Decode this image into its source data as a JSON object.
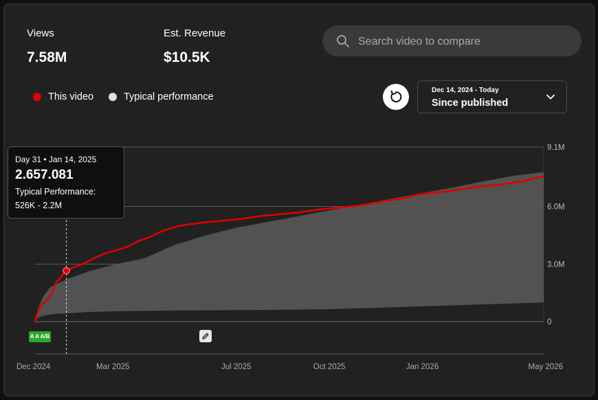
{
  "metrics": {
    "views_label": "Views",
    "views_value": "7.58M",
    "revenue_label": "Est. Revenue",
    "revenue_value": "$10.5K"
  },
  "search": {
    "placeholder": "Search video to compare",
    "icon": "search-icon"
  },
  "legend": {
    "this_video": {
      "label": "This video",
      "color": "#e00000"
    },
    "typical": {
      "label": "Typical performance",
      "color": "#e0e0e0"
    }
  },
  "date_picker": {
    "range": "Dec 14, 2024 - Today",
    "label": "Since published",
    "icon": "chevron-down-icon"
  },
  "refresh": {
    "icon": "refresh-icon"
  },
  "tooltip": {
    "date": "Day 31 • Jan 14, 2025",
    "value": "2.657.081",
    "label": "Typical Performance:",
    "range": "526K - 2.2M"
  },
  "badge": {
    "label": "A A A/B"
  },
  "annotation": {
    "icon": "pencil-icon"
  },
  "colors": {
    "background": "#212121",
    "series": "#e00000",
    "band": "#5a5a5a",
    "grid": "#5f5f5f"
  },
  "chart_data": {
    "type": "line",
    "title": "",
    "x_tick_labels": [
      "Dec 2024",
      "Mar 2025",
      "Jul 2025",
      "Oct 2025",
      "Jan 2026",
      "May 2026"
    ],
    "x_tick_dates": [
      "2024-12-14",
      "2025-03-01",
      "2025-07-01",
      "2025-10-01",
      "2026-01-01",
      "2026-05-01"
    ],
    "y_tick_labels": [
      "0",
      "3.0M",
      "6.0M",
      "9.1M"
    ],
    "y_tick_values": [
      0,
      3000000,
      6000000,
      9100000
    ],
    "ylim": [
      0,
      9100000
    ],
    "x_range": [
      "2024-12-14",
      "2026-05-01"
    ],
    "grid": true,
    "hover_date": "2025-01-14",
    "series": [
      {
        "name": "This video",
        "x": [
          "2024-12-14",
          "2024-12-16",
          "2024-12-19",
          "2024-12-22",
          "2024-12-26",
          "2024-12-30",
          "2025-01-04",
          "2025-01-09",
          "2025-01-14",
          "2025-01-22",
          "2025-02-01",
          "2025-02-10",
          "2025-02-21",
          "2025-03-06",
          "2025-03-15",
          "2025-03-26",
          "2025-04-06",
          "2025-04-20",
          "2025-05-06",
          "2025-05-26",
          "2025-06-15",
          "2025-07-05",
          "2025-07-24",
          "2025-08-13",
          "2025-09-02",
          "2025-09-22",
          "2025-10-12",
          "2025-11-01",
          "2025-11-21",
          "2025-12-10",
          "2025-12-30",
          "2026-01-19",
          "2026-02-08",
          "2026-02-28",
          "2026-03-20",
          "2026-04-09",
          "2026-05-01"
        ],
        "y": [
          0,
          400000,
          750000,
          950000,
          1150000,
          1450000,
          2050000,
          2350000,
          2657081,
          2850000,
          3050000,
          3300000,
          3550000,
          3750000,
          3900000,
          4200000,
          4400000,
          4750000,
          5000000,
          5150000,
          5250000,
          5350000,
          5500000,
          5600000,
          5700000,
          5850000,
          5950000,
          6050000,
          6250000,
          6400000,
          6650000,
          6750000,
          6900000,
          7050000,
          7150000,
          7300000,
          7580000
        ]
      },
      {
        "name": "Typical performance",
        "x": [
          "2024-12-14",
          "2024-12-17",
          "2024-12-22",
          "2024-12-29",
          "2025-01-14",
          "2025-02-04",
          "2025-03-04",
          "2025-04-01",
          "2025-05-01",
          "2025-06-01",
          "2025-07-01",
          "2025-08-01",
          "2025-09-01",
          "2025-10-01",
          "2025-11-01",
          "2025-12-01",
          "2026-01-01",
          "2026-02-01",
          "2026-03-01",
          "2026-04-01",
          "2026-05-01"
        ],
        "upper": [
          0,
          700000,
          1300000,
          1800000,
          2200000,
          2600000,
          3000000,
          3300000,
          4000000,
          4500000,
          4900000,
          5200000,
          5500000,
          5800000,
          6100000,
          6400000,
          6700000,
          7000000,
          7300000,
          7600000,
          7800000
        ],
        "lower": [
          0,
          200000,
          300000,
          380000,
          430000,
          500000,
          540000,
          560000,
          580000,
          590000,
          600000,
          610000,
          630000,
          650000,
          700000,
          750000,
          800000,
          850000,
          900000,
          950000,
          1000000
        ]
      }
    ]
  }
}
